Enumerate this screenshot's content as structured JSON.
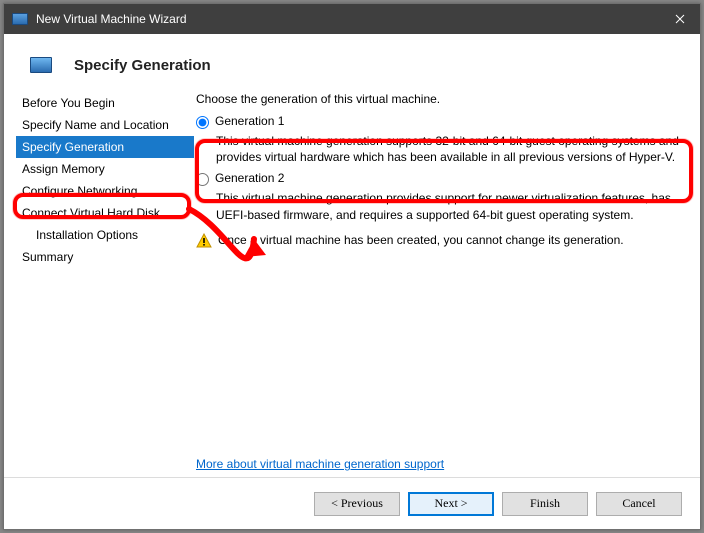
{
  "window": {
    "title": "New Virtual Machine Wizard"
  },
  "header": {
    "title": "Specify Generation"
  },
  "sidebar": {
    "items": [
      {
        "label": "Before You Begin"
      },
      {
        "label": "Specify Name and Location"
      },
      {
        "label": "Specify Generation"
      },
      {
        "label": "Assign Memory"
      },
      {
        "label": "Configure Networking"
      },
      {
        "label": "Connect Virtual Hard Disk"
      },
      {
        "label": "Installation Options"
      },
      {
        "label": "Summary"
      }
    ],
    "active_index": 2
  },
  "content": {
    "intro": "Choose the generation of this virtual machine.",
    "options": [
      {
        "label": "Generation 1",
        "desc": "This virtual machine generation supports 32-bit and 64-bit guest operating systems and provides virtual hardware which has been available in all previous versions of Hyper-V.",
        "checked": true
      },
      {
        "label": "Generation 2",
        "desc": "This virtual machine generation provides support for newer virtualization features, has UEFI-based firmware, and requires a supported 64-bit guest operating system.",
        "checked": false
      }
    ],
    "warning": "Once a virtual machine has been created, you cannot change its generation.",
    "link": "More about virtual machine generation support"
  },
  "footer": {
    "previous": "< Previous",
    "next": "Next >",
    "finish": "Finish",
    "cancel": "Cancel"
  }
}
